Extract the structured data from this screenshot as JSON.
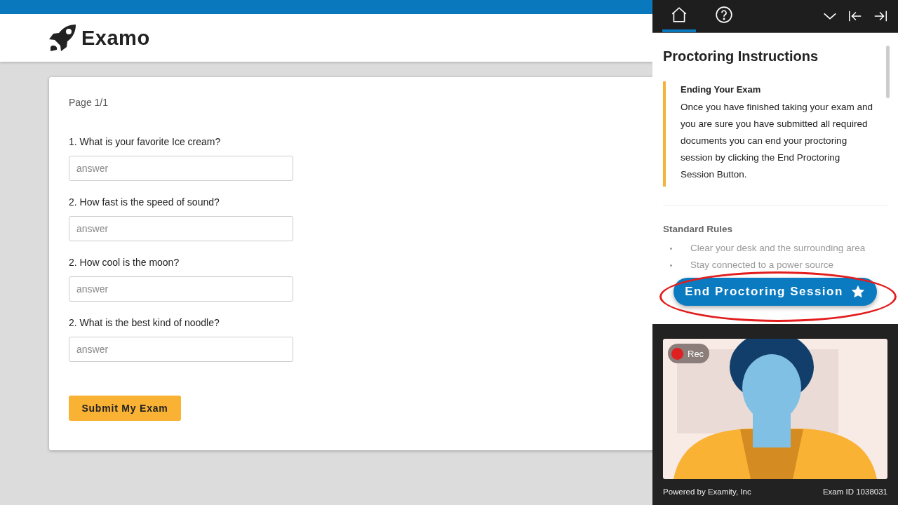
{
  "header": {
    "logo_text": "Examo"
  },
  "exam": {
    "page_label": "Page 1/1",
    "questions": [
      {
        "text": "1. What is your favorite Ice cream?",
        "placeholder": "answer"
      },
      {
        "text": "2. How fast is the speed of sound?",
        "placeholder": "answer"
      },
      {
        "text": "2. How cool is the moon?",
        "placeholder": "answer"
      },
      {
        "text": "2. What is the best kind of noodle?",
        "placeholder": "answer"
      }
    ],
    "submit_button": "Submit My Exam"
  },
  "panel": {
    "tabs": [
      {
        "kind": "home",
        "selected": true
      },
      {
        "kind": "help",
        "selected": false
      }
    ],
    "toolbar": [
      {
        "kind": "collapse"
      },
      {
        "kind": "dock-left"
      },
      {
        "kind": "dock-right"
      }
    ],
    "title": "Proctoring Instructions",
    "callout": {
      "heading": "Ending Your Exam",
      "body": "Once you have finished taking your exam and you are sure you have submitted all required documents you can end your proctoring session by clicking the End Proctoring Session Button."
    },
    "rules_heading": "Standard Rules",
    "rules": [
      "Clear your desk and the surrounding area",
      "Stay connected to a power source"
    ],
    "end_button": "End Proctoring Session",
    "recording": {
      "on": true,
      "label": "Rec"
    },
    "footer_left": "Powered by Examity, Inc",
    "footer_right": "Exam ID 1038031"
  }
}
